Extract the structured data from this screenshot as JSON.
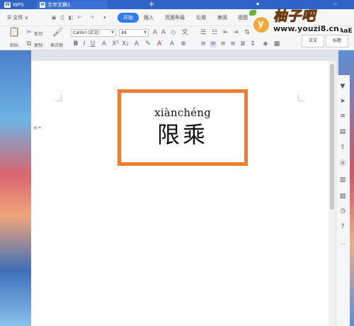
{
  "titlebar": {
    "app_tab": "WPS",
    "doc_tab": "文字文稿1",
    "close_glyph": "×",
    "add_glyph": "+"
  },
  "menu": {
    "file": "☰ 文件 ∨",
    "items": [
      "开始",
      "插入",
      "页面布局",
      "引用",
      "审阅",
      "视图"
    ]
  },
  "ribbon": {
    "paste": "粘贴",
    "cut": "剪切",
    "copy": "复制",
    "format_painter": "格式刷",
    "font_name": "Calibri (正文)",
    "font_size": "48",
    "style_normal": "正文",
    "style_heading": "标题",
    "style_preview": "AaE"
  },
  "document": {
    "pinyin": "xiànchéng",
    "hanzi": "限乘"
  },
  "watermark": {
    "brand": "柚子吧",
    "url": "www.youzi8.cn",
    "logo_letter": "y"
  },
  "colors": {
    "titlebar": "#2f63c6",
    "accent": "#2f7bf0",
    "highlight_border": "#ee7d2f"
  }
}
